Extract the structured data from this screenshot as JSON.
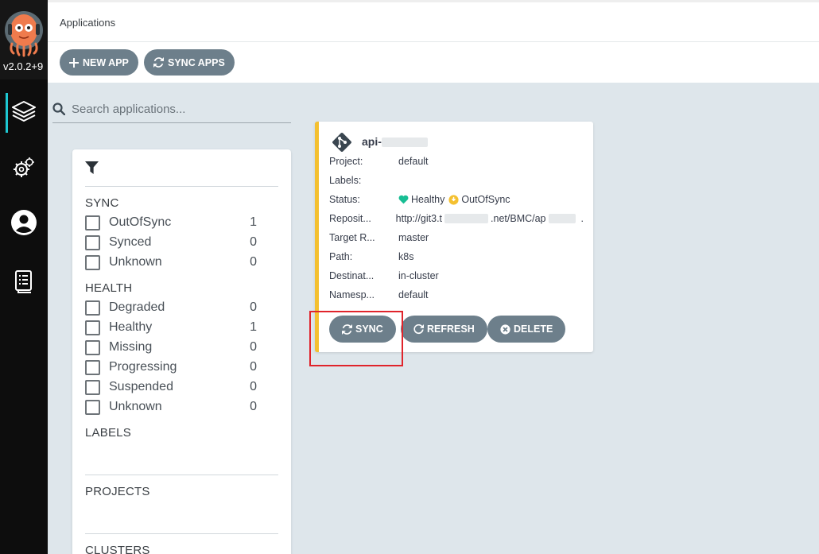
{
  "app": {
    "version": "v2.0.2+9"
  },
  "sidebar": {
    "items": [
      {
        "name": "applications",
        "icon": "layers-icon",
        "active": true
      },
      {
        "name": "settings",
        "icon": "gears-icon",
        "active": false
      },
      {
        "name": "user-info",
        "icon": "user-circle-icon",
        "active": false
      },
      {
        "name": "docs",
        "icon": "docs-icon",
        "active": false
      }
    ]
  },
  "header": {
    "title": "Applications",
    "new_app_label": "NEW APP",
    "sync_apps_label": "SYNC APPS"
  },
  "search": {
    "placeholder": "Search applications...",
    "value": ""
  },
  "filters": {
    "sync_title": "SYNC",
    "sync": [
      {
        "label": "OutOfSync",
        "count": "1"
      },
      {
        "label": "Synced",
        "count": "0"
      },
      {
        "label": "Unknown",
        "count": "0"
      }
    ],
    "health_title": "HEALTH",
    "health": [
      {
        "label": "Degraded",
        "count": "0"
      },
      {
        "label": "Healthy",
        "count": "1"
      },
      {
        "label": "Missing",
        "count": "0"
      },
      {
        "label": "Progressing",
        "count": "0"
      },
      {
        "label": "Suspended",
        "count": "0"
      },
      {
        "label": "Unknown",
        "count": "0"
      }
    ],
    "labels_title": "LABELS",
    "projects_title": "PROJECTS",
    "clusters_title": "CLUSTERS"
  },
  "card": {
    "name_prefix": "api-",
    "project_key": "Project:",
    "project": "default",
    "labels_key": "Labels:",
    "labels": "",
    "status_key": "Status:",
    "health": "Healthy",
    "sync_status": "OutOfSync",
    "repo_key": "Reposit...",
    "repo_prefix": "http://git3.t",
    "repo_mid": ".net/BMC/ap",
    "repo_suffix": ".",
    "target_key": "Target R...",
    "target": "master",
    "path_key": "Path:",
    "path": "k8s",
    "dest_key": "Destinat...",
    "dest": "in-cluster",
    "ns_key": "Namesp...",
    "ns": "default",
    "sync_label": "SYNC",
    "refresh_label": "REFRESH",
    "delete_label": "DELETE"
  },
  "colors": {
    "sidebar": "#0d0d0d",
    "accent": "#1ec8d2",
    "button": "#6d7f8b",
    "healthy": "#18be94",
    "out_of_sync": "#f4c030",
    "highlight": "#e0242b"
  }
}
